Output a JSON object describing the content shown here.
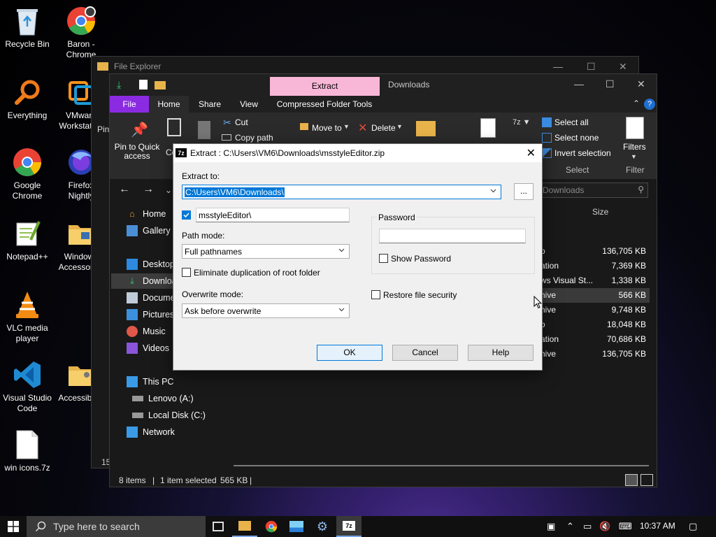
{
  "desktop": {
    "icons": [
      {
        "label": "Recycle Bin"
      },
      {
        "label": "Baron - Chrome"
      },
      {
        "label": "Everything"
      },
      {
        "label": "VMware Workstation"
      },
      {
        "label": "Google Chrome"
      },
      {
        "label": "Firefox Nightly"
      },
      {
        "label": "Notepad++"
      },
      {
        "label": "Windows Accessories"
      },
      {
        "label": "VLC media player"
      },
      {
        "label": "Visual Studio Code"
      },
      {
        "label": "Accessibility"
      },
      {
        "label": "win icons.7z"
      }
    ]
  },
  "back_explorer": {
    "title": "File Explorer",
    "pin_fragment": "Pin",
    "status_fragment": "15"
  },
  "explorer": {
    "context_tab": "Extract",
    "title": "Downloads",
    "tabs": [
      "File",
      "Home",
      "Share",
      "View",
      "Compressed Folder Tools"
    ],
    "ribbon": {
      "pin_to_quick_access": "Pin to Quick access",
      "copy_fragment": "Co",
      "cut": "Cut",
      "copy_path": "Copy path",
      "move_to": "Move to",
      "delete": "Delete",
      "select_all": "Select all",
      "select_none": "Select none",
      "invert_selection": "Invert selection",
      "select_group": "Select",
      "filters": "Filters",
      "filter_group": "Filter"
    },
    "search_placeholder": "Downloads",
    "nav": {
      "home": "Home",
      "gallery": "Gallery",
      "desktop": "Desktop",
      "downloads": "Downloads",
      "documents": "Documents",
      "pictures": "Pictures",
      "music": "Music",
      "videos": "Videos",
      "this_pc": "This PC",
      "lenovo": "Lenovo (A:)",
      "local_disk": "Local Disk (C:)",
      "network": "Network"
    },
    "size_header": "Size",
    "files": [
      {
        "type": "o",
        "size": "136,705 KB"
      },
      {
        "type": "ation",
        "size": "7,369 KB"
      },
      {
        "type": "ws Visual St...",
        "size": "1,338 KB"
      },
      {
        "type": "hive",
        "size": "566 KB"
      },
      {
        "type": "hive",
        "size": "9,748 KB"
      },
      {
        "type": "o",
        "size": "18,048 KB"
      },
      {
        "type": "ation",
        "size": "70,686 KB"
      },
      {
        "type": "hive",
        "size": "136,705 KB"
      }
    ],
    "status": {
      "items": "8 items",
      "selected": "1 item selected",
      "size": "565 KB"
    }
  },
  "dialog": {
    "title": "Extract : C:\\Users\\VM6\\Downloads\\msstyleEditor.zip",
    "extract_to_label": "Extract to:",
    "extract_to_value": "C:\\Users\\VM6\\Downloads\\",
    "browse_label": "...",
    "subfolder_value": "msstyleEditor\\",
    "subfolder_checked": true,
    "path_mode_label": "Path mode:",
    "path_mode_value": "Full pathnames",
    "eliminate_dup_label": "Eliminate duplication of root folder",
    "overwrite_mode_label": "Overwrite mode:",
    "overwrite_mode_value": "Ask before overwrite",
    "password_label": "Password",
    "show_password_label": "Show Password",
    "restore_security_label": "Restore file security",
    "ok_label": "OK",
    "cancel_label": "Cancel",
    "help_label": "Help"
  },
  "taskbar": {
    "search_placeholder": "Type here to search",
    "time": "10:37 AM"
  },
  "colors": {
    "accent": "#0078d7",
    "file_tab": "#8a2be2",
    "context_tab": "#f8b7d7"
  }
}
